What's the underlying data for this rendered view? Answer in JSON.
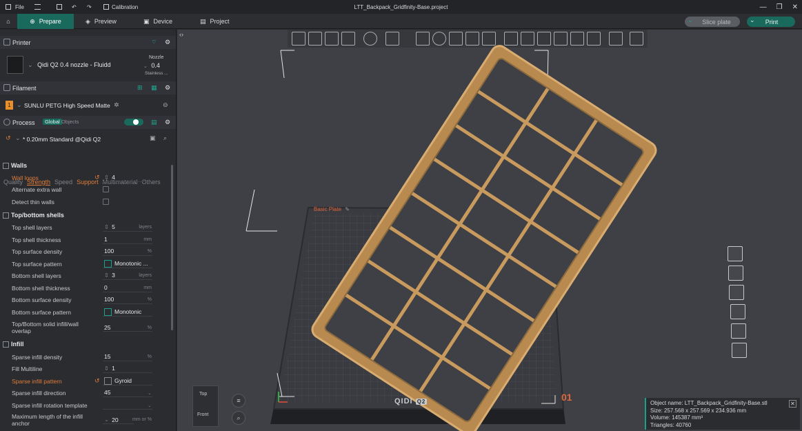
{
  "titlebar": {
    "file": "File",
    "calibration": "Calibration",
    "title": "LTT_Backpack_Gridfinity-Base.project"
  },
  "tabs": {
    "prepare": "Prepare",
    "preview": "Preview",
    "device": "Device",
    "project": "Project"
  },
  "actions": {
    "slice": "Slice plate",
    "print": "Print"
  },
  "printer": {
    "header": "Printer",
    "name": "Qidi Q2 0.4 nozzle - Fluidd",
    "nozzle_label": "Nozzle",
    "nozzle_value": "0.4",
    "nozzle_material": "Stainless ..."
  },
  "filament": {
    "header": "Filament",
    "index": "1",
    "name": "SUNLU PETG High Speed Matte"
  },
  "process": {
    "header": "Process",
    "global": "Global",
    "objects": "Objects",
    "preset": "* 0.20mm Standard @Qidi Q2"
  },
  "subtabs": [
    "Quality",
    "Strength",
    "Speed",
    "Support",
    "Multimaterial",
    "Others"
  ],
  "groups": {
    "walls": "Walls",
    "shells": "Top/bottom shells",
    "infill": "Infill"
  },
  "settings": {
    "wall_loops": {
      "label": "Wall loops",
      "value": "4"
    },
    "alternate_extra_wall": {
      "label": "Alternate extra wall"
    },
    "detect_thin_walls": {
      "label": "Detect thin walls"
    },
    "top_shell_layers": {
      "label": "Top shell layers",
      "value": "5",
      "unit": "layers"
    },
    "top_shell_thickness": {
      "label": "Top shell thickness",
      "value": "1",
      "unit": "mm"
    },
    "top_surface_density": {
      "label": "Top surface density",
      "value": "100",
      "unit": "%"
    },
    "top_surface_pattern": {
      "label": "Top surface pattern",
      "value": "Monotonic ..."
    },
    "bottom_shell_layers": {
      "label": "Bottom shell layers",
      "value": "3",
      "unit": "layers"
    },
    "bottom_shell_thickness": {
      "label": "Bottom shell thickness",
      "value": "0",
      "unit": "mm"
    },
    "bottom_surface_density": {
      "label": "Bottom surface density",
      "value": "100",
      "unit": "%"
    },
    "bottom_surface_pattern": {
      "label": "Bottom surface pattern",
      "value": "Monotonic"
    },
    "solid_infill_overlap": {
      "label1": "Top/Bottom solid infill/wall",
      "label2": "overlap",
      "value": "25",
      "unit": "%"
    },
    "sparse_infill_density": {
      "label": "Sparse infill density",
      "value": "15",
      "unit": "%"
    },
    "fill_multiline": {
      "label": "Fill Multiline",
      "value": "1"
    },
    "sparse_infill_pattern": {
      "label": "Sparse infill pattern",
      "value": "Gyroid"
    },
    "sparse_infill_direction": {
      "label": "Sparse infill direction",
      "value": "45"
    },
    "sparse_infill_rotation": {
      "label": "Sparse infill rotation template"
    },
    "max_infill_anchor": {
      "label1": "Maximum length of the infill",
      "label2": "anchor",
      "value": "20",
      "unit": "mm or %"
    }
  },
  "viewport": {
    "plate_label": "Basic Plate",
    "brand": "QIDI",
    "brand_model": "Q2",
    "plate_number": "01",
    "view_top": "Top",
    "view_front": "Front"
  },
  "object_info": {
    "name": "Object name: LTT_Backpack_Gridfinity-Base.stl",
    "size": "Size: 257.568 x 257.569 x 234.936 mm",
    "volume": "Volume: 145387 mm³",
    "triangles": "Triangles: 40760"
  },
  "colors": {
    "accent": "#19695d",
    "accent_bright": "#1fa58f",
    "modified": "#e07d3a",
    "model": "#c99a5e"
  }
}
